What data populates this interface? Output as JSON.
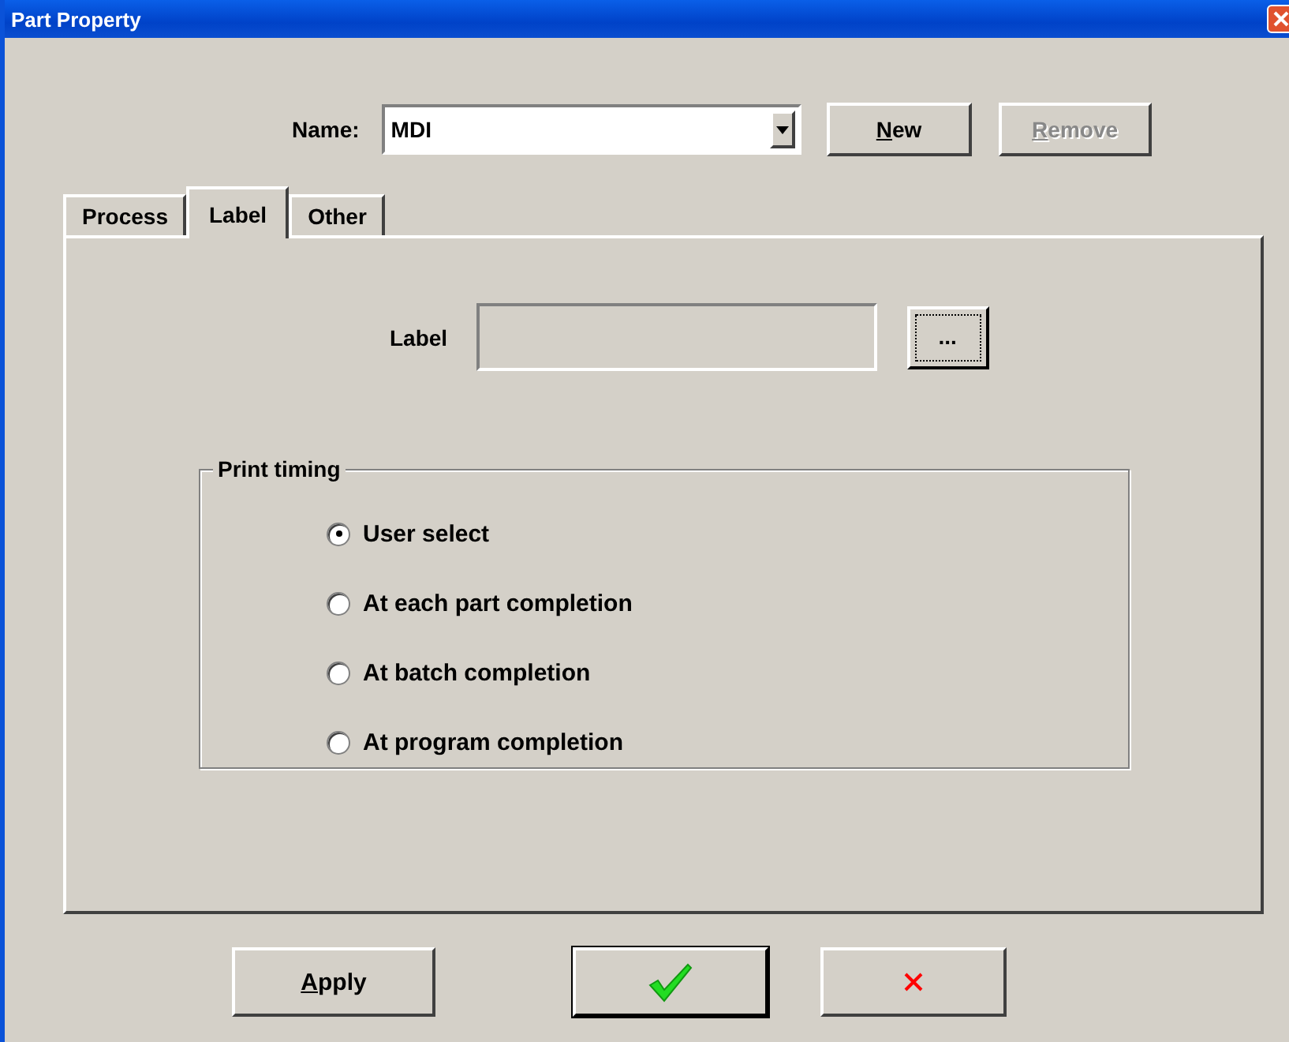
{
  "window": {
    "title": "Part Property"
  },
  "name_field": {
    "label": "Name:",
    "value": "MDI"
  },
  "header_buttons": [
    {
      "label": "New",
      "disabled": false
    },
    {
      "label": "Remove",
      "disabled": true
    }
  ],
  "tabs": [
    {
      "label": "Process",
      "selected": false
    },
    {
      "label": "Label",
      "selected": true
    },
    {
      "label": "Other",
      "selected": false
    }
  ],
  "label_field": {
    "label": "Label",
    "browse": "..."
  },
  "print_timing": {
    "title": "Print timing",
    "options": [
      {
        "label": "User select",
        "selected": true
      },
      {
        "label": "At each part completion",
        "selected": false
      },
      {
        "label": "At batch completion",
        "selected": false
      },
      {
        "label": "At program completion",
        "selected": false
      }
    ]
  },
  "footer_buttons": [
    {
      "kind": "text",
      "label": "Apply"
    },
    {
      "kind": "ok"
    },
    {
      "kind": "cancel"
    }
  ]
}
